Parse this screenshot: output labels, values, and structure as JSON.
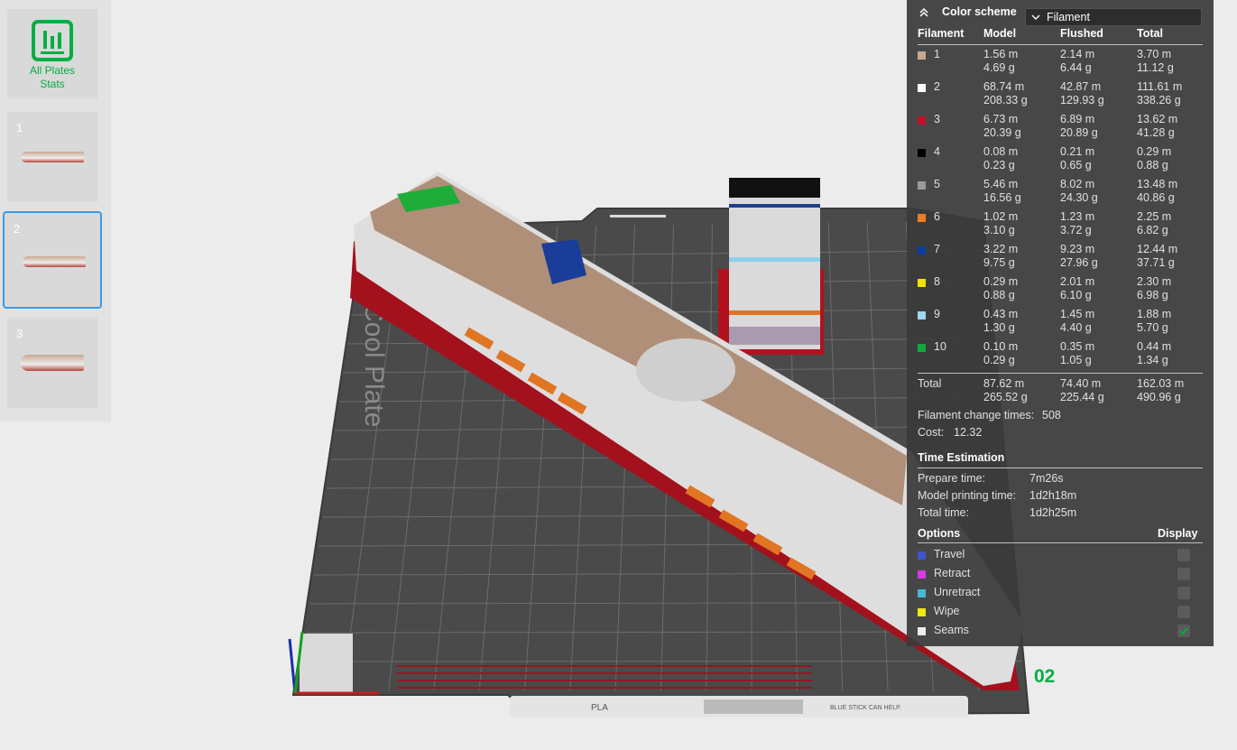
{
  "sidebar": {
    "all_plates_line1": "All Plates",
    "all_plates_line2": "Stats",
    "plates": [
      "1",
      "2",
      "3"
    ]
  },
  "bed": {
    "label": "Cool Plate",
    "plate_number": "02",
    "filament_type": "PLA",
    "notice": "BLUE STICK CAN HELP."
  },
  "stats": {
    "color_scheme_label": "Color scheme",
    "color_scheme_value": "Filament",
    "columns": [
      "Filament",
      "Model",
      "Flushed",
      "Total"
    ],
    "filaments": [
      {
        "id": "1",
        "color": "#c8a993",
        "model_m": "1.56 m",
        "model_g": "4.69 g",
        "flushed_m": "2.14 m",
        "flushed_g": "6.44 g",
        "total_m": "3.70 m",
        "total_g": "11.12 g"
      },
      {
        "id": "2",
        "color": "#ffffff",
        "model_m": "68.74 m",
        "model_g": "208.33 g",
        "flushed_m": "42.87 m",
        "flushed_g": "129.93 g",
        "total_m": "111.61 m",
        "total_g": "338.26 g"
      },
      {
        "id": "3",
        "color": "#c4102a",
        "model_m": "6.73 m",
        "model_g": "20.39 g",
        "flushed_m": "6.89 m",
        "flushed_g": "20.89 g",
        "total_m": "13.62 m",
        "total_g": "41.28 g"
      },
      {
        "id": "4",
        "color": "#000000",
        "model_m": "0.08 m",
        "model_g": "0.23 g",
        "flushed_m": "0.21 m",
        "flushed_g": "0.65 g",
        "total_m": "0.29 m",
        "total_g": "0.88 g"
      },
      {
        "id": "5",
        "color": "#9a9a9a",
        "model_m": "5.46 m",
        "model_g": "16.56 g",
        "flushed_m": "8.02 m",
        "flushed_g": "24.30 g",
        "total_m": "13.48 m",
        "total_g": "40.86 g"
      },
      {
        "id": "6",
        "color": "#f07c22",
        "model_m": "1.02 m",
        "model_g": "3.10 g",
        "flushed_m": "1.23 m",
        "flushed_g": "3.72 g",
        "total_m": "2.25 m",
        "total_g": "6.82 g"
      },
      {
        "id": "7",
        "color": "#0a3d9e",
        "model_m": "3.22 m",
        "model_g": "9.75 g",
        "flushed_m": "9.23 m",
        "flushed_g": "27.96 g",
        "total_m": "12.44 m",
        "total_g": "37.71 g"
      },
      {
        "id": "8",
        "color": "#f5e000",
        "model_m": "0.29 m",
        "model_g": "0.88 g",
        "flushed_m": "2.01 m",
        "flushed_g": "6.10 g",
        "total_m": "2.30 m",
        "total_g": "6.98 g"
      },
      {
        "id": "9",
        "color": "#9fd8ef",
        "model_m": "0.43 m",
        "model_g": "1.30 g",
        "flushed_m": "1.45 m",
        "flushed_g": "4.40 g",
        "total_m": "1.88 m",
        "total_g": "5.70 g"
      },
      {
        "id": "10",
        "color": "#12a83c",
        "model_m": "0.10 m",
        "model_g": "0.29 g",
        "flushed_m": "0.35 m",
        "flushed_g": "1.05 g",
        "total_m": "0.44 m",
        "total_g": "1.34 g"
      }
    ],
    "total": {
      "label": "Total",
      "model_m": "87.62 m",
      "model_g": "265.52 g",
      "flushed_m": "74.40 m",
      "flushed_g": "225.44 g",
      "total_m": "162.03 m",
      "total_g": "490.96 g"
    },
    "change_times_label": "Filament change times:",
    "change_times_value": "508",
    "cost_label": "Cost:",
    "cost_value": "12.32",
    "time_title": "Time Estimation",
    "prepare_label": "Prepare time:",
    "prepare_value": "7m26s",
    "model_print_label": "Model printing time:",
    "model_print_value": "1d2h18m",
    "total_time_label": "Total time:",
    "total_time_value": "1d2h25m",
    "options_title": "Options",
    "display_title": "Display",
    "options": [
      {
        "label": "Travel",
        "color": "#3f57c8",
        "checked": false
      },
      {
        "label": "Retract",
        "color": "#d43be0",
        "checked": false
      },
      {
        "label": "Unretract",
        "color": "#45b9d6",
        "checked": false
      },
      {
        "label": "Wipe",
        "color": "#f0e812",
        "checked": false
      },
      {
        "label": "Seams",
        "color": "#eeeeee",
        "checked": true
      }
    ]
  },
  "colors": {
    "accent_green": "#00ae42",
    "selection_blue": "#3a9be8",
    "panel_bg": "#3a3a3a",
    "bed_grid": "#4a4a4a",
    "brim_red": "#9b1420"
  }
}
